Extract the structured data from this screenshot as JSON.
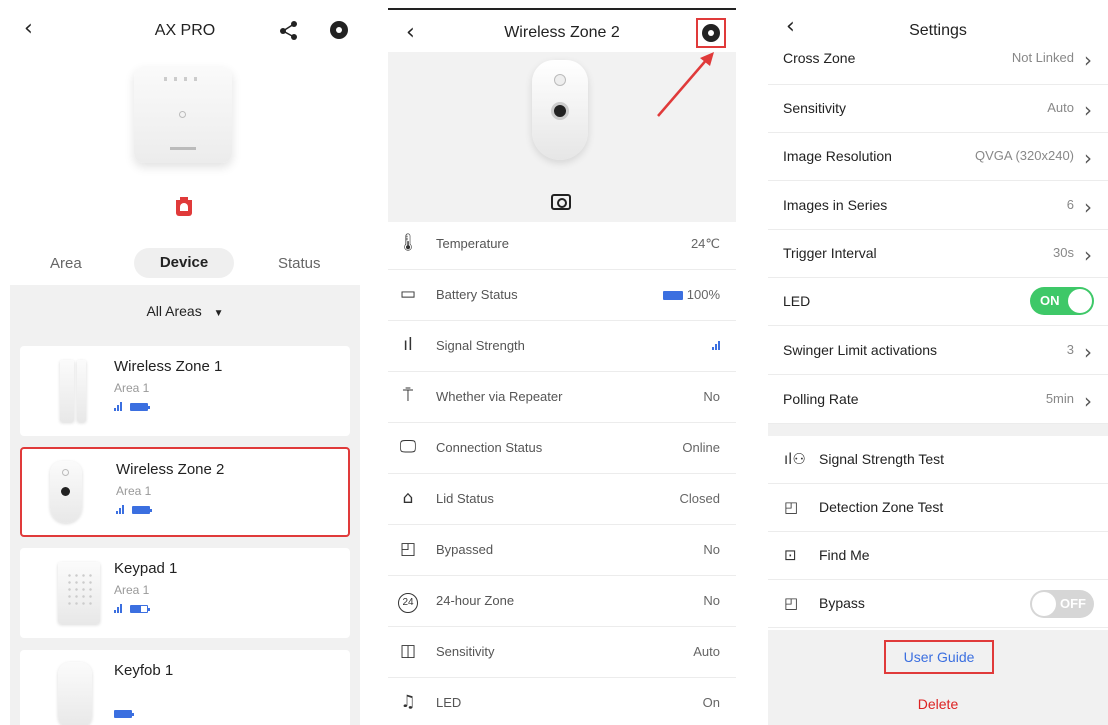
{
  "panel1": {
    "title": "AX PRO",
    "tabs": [
      "Area",
      "Device",
      "Status"
    ],
    "filter_label": "All Areas",
    "devices": [
      {
        "name": "Wireless Zone 1",
        "area": "Area 1",
        "battery": 1.0
      },
      {
        "name": "Wireless Zone 2",
        "area": "Area 1",
        "battery": 1.0
      },
      {
        "name": "Keypad 1",
        "area": "Area 1",
        "battery": 0.6
      },
      {
        "name": "Keyfob 1",
        "area": "",
        "battery": 1.0
      }
    ]
  },
  "panel2": {
    "title": "Wireless Zone 2",
    "rows": [
      {
        "icon": "thermometer-icon",
        "label": "Temperature",
        "value": "24℃"
      },
      {
        "icon": "battery-icon",
        "label": "Battery Status",
        "value": "100%"
      },
      {
        "icon": "signal-icon",
        "label": "Signal Strength",
        "value": ""
      },
      {
        "icon": "repeater-icon",
        "label": "Whether via Repeater",
        "value": "No"
      },
      {
        "icon": "monitor-icon",
        "label": "Connection Status",
        "value": "Online"
      },
      {
        "icon": "lid-icon",
        "label": "Lid Status",
        "value": "Closed"
      },
      {
        "icon": "bypass-icon",
        "label": "Bypassed",
        "value": "No"
      },
      {
        "icon": "24-hour-icon",
        "label": "24-hour Zone",
        "value": "No"
      },
      {
        "icon": "sensitivity-icon",
        "label": "Sensitivity",
        "value": "Auto"
      },
      {
        "icon": "bell-icon",
        "label": "LED",
        "value": "On"
      }
    ],
    "badge_24": "24"
  },
  "panel3": {
    "title": "Settings",
    "rows": [
      {
        "label": "Cross Zone",
        "value": "Not Linked"
      },
      {
        "label": "Sensitivity",
        "value": "Auto"
      },
      {
        "label": "Image Resolution",
        "value": "QVGA (320x240)"
      },
      {
        "label": "Images in Series",
        "value": "6"
      },
      {
        "label": "Trigger Interval",
        "value": "30s"
      },
      {
        "label": "LED",
        "toggle": "ON"
      },
      {
        "label": "Swinger Limit activations",
        "value": "3"
      },
      {
        "label": "Polling Rate",
        "value": "5min"
      }
    ],
    "tests": [
      {
        "icon": "signal-test-icon",
        "label": "Signal Strength Test"
      },
      {
        "icon": "detection-zone-icon",
        "label": "Detection Zone Test"
      },
      {
        "icon": "find-me-icon",
        "label": "Find Me"
      },
      {
        "icon": "bypass-icon",
        "label": "Bypass",
        "toggle": "OFF"
      }
    ],
    "user_guide": "User Guide",
    "delete": "Delete"
  },
  "colors": {
    "accent": "#3b6fe0",
    "highlight": "#e03a3a",
    "toggle_on": "#3ec868",
    "delete": "#dd2222"
  }
}
